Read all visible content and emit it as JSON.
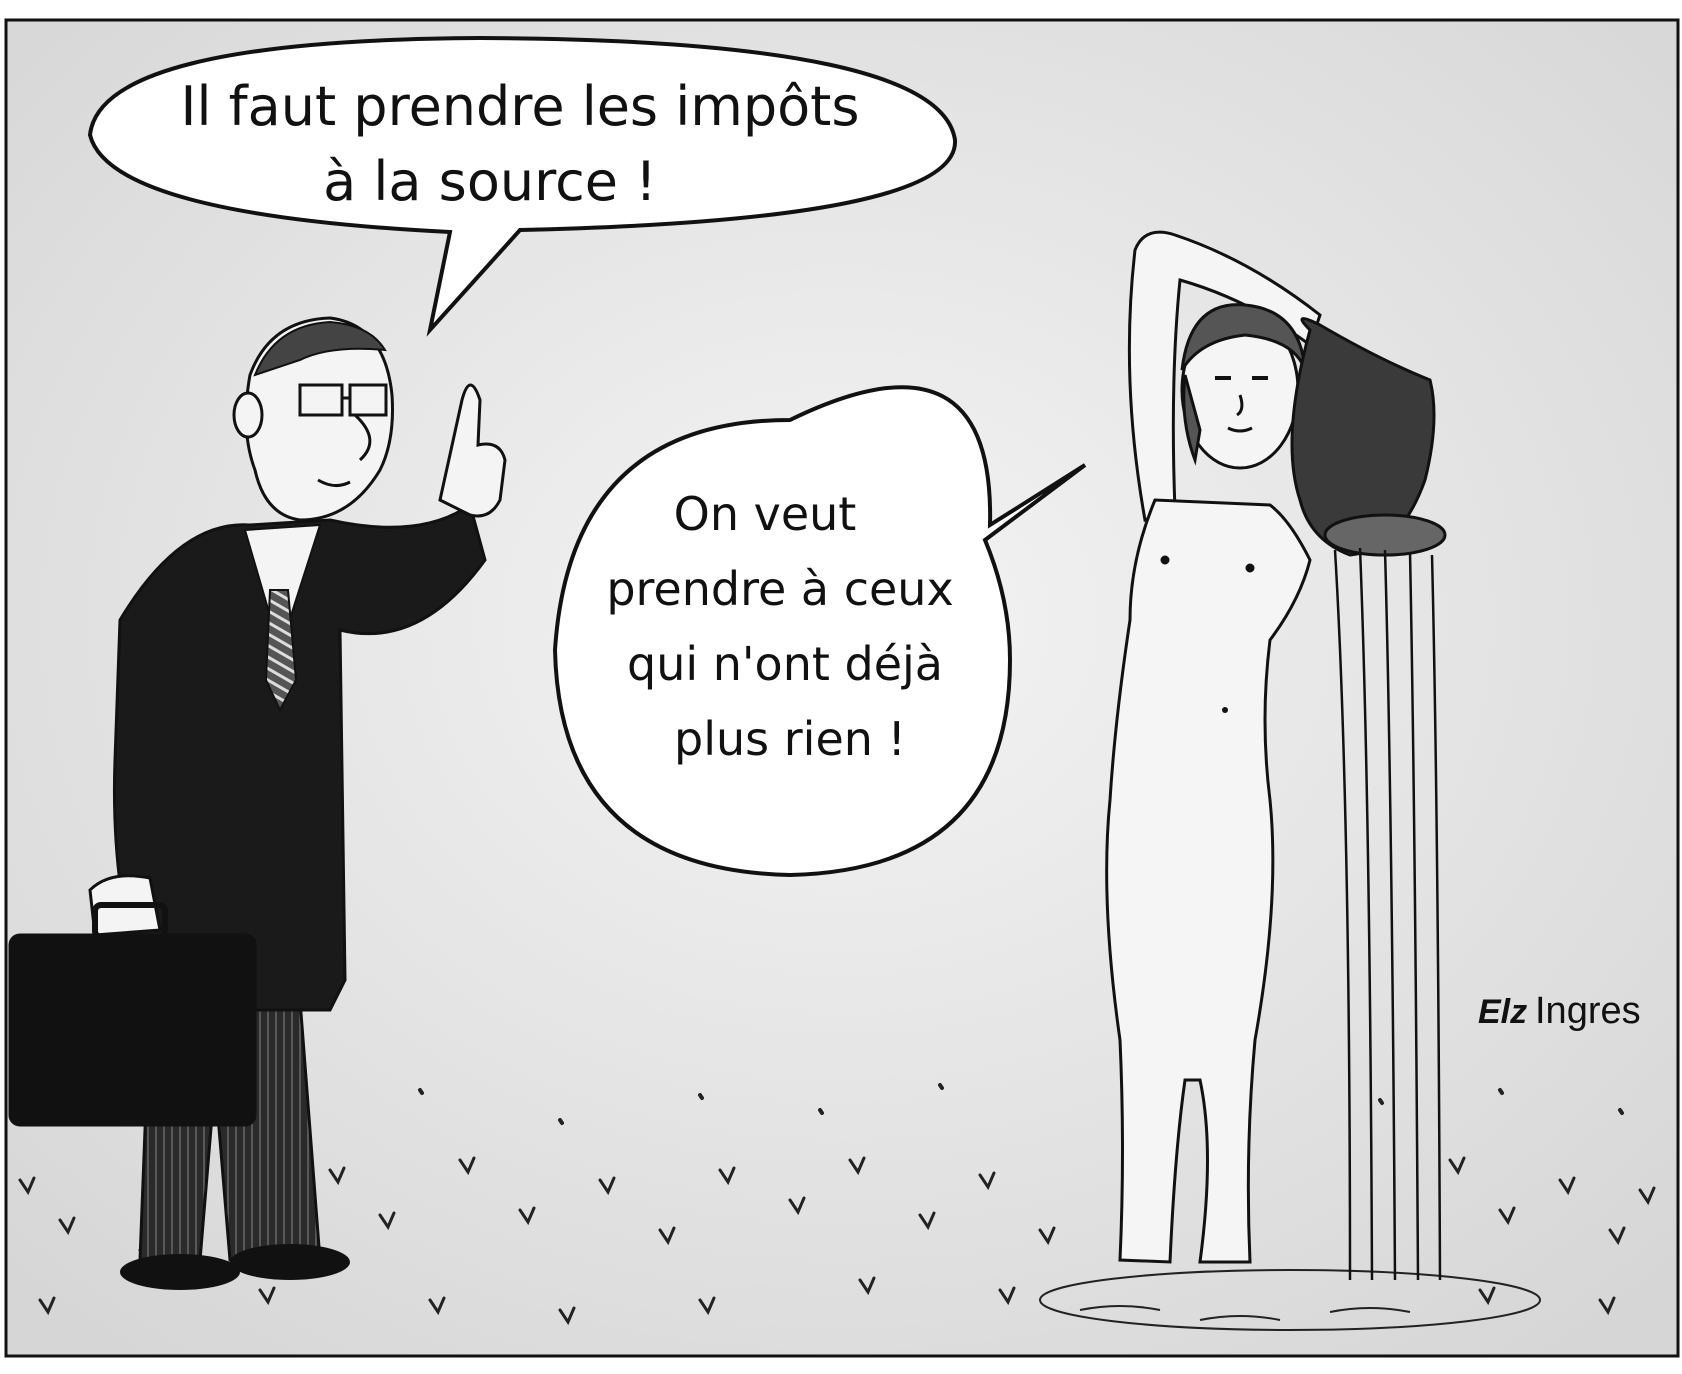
{
  "speech": {
    "man_line1": "Il faut prendre les impôts",
    "man_line2": "à la source !",
    "woman_line1": "On veut",
    "woman_line2": "prendre à ceux",
    "woman_line3": "qui n'ont déjà",
    "woman_line4": "plus rien !"
  },
  "signature": {
    "artist": "Elz",
    "reference": "Ingres"
  },
  "colors": {
    "background": "#e8e8e8",
    "ink": "#111111",
    "suit": "#1a1a1a",
    "jug": "#3a3a3a"
  }
}
